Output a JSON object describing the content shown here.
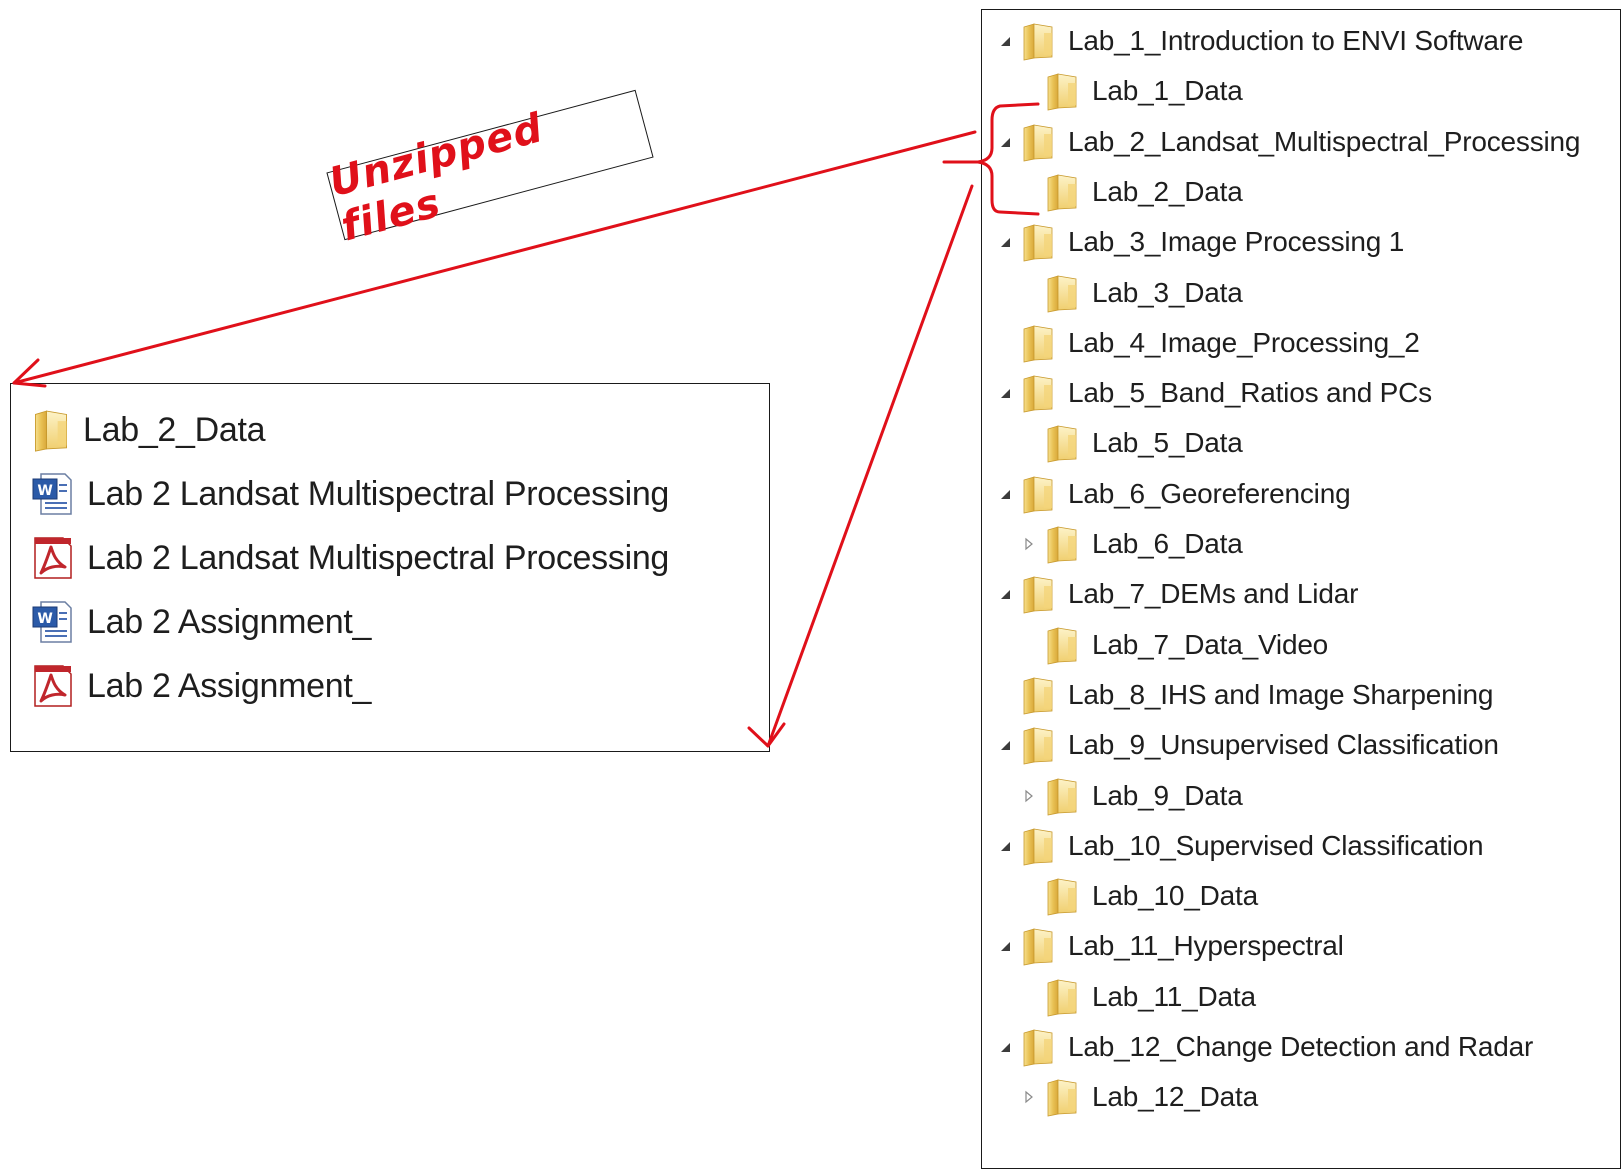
{
  "annotation": {
    "label": "Unzipped files",
    "color": "#e0101a"
  },
  "folder_tree": {
    "items": [
      {
        "label": "Lab_1_Introduction to ENVI Software",
        "level": 0,
        "toggle": "expanded"
      },
      {
        "label": "Lab_1_Data",
        "level": 1,
        "toggle": "none"
      },
      {
        "label": "Lab_2_Landsat_Multispectral_Processing",
        "level": 0,
        "toggle": "expanded"
      },
      {
        "label": "Lab_2_Data",
        "level": 1,
        "toggle": "none"
      },
      {
        "label": "Lab_3_Image Processing 1",
        "level": 0,
        "toggle": "expanded"
      },
      {
        "label": "Lab_3_Data",
        "level": 1,
        "toggle": "none"
      },
      {
        "label": "Lab_4_Image_Processing_2",
        "level": 0,
        "toggle": "none"
      },
      {
        "label": "Lab_5_Band_Ratios and PCs",
        "level": 0,
        "toggle": "expanded"
      },
      {
        "label": "Lab_5_Data",
        "level": 1,
        "toggle": "none"
      },
      {
        "label": "Lab_6_Georeferencing",
        "level": 0,
        "toggle": "expanded"
      },
      {
        "label": "Lab_6_Data",
        "level": 1,
        "toggle": "collapsed"
      },
      {
        "label": "Lab_7_DEMs and Lidar",
        "level": 0,
        "toggle": "expanded"
      },
      {
        "label": "Lab_7_Data_Video",
        "level": 1,
        "toggle": "none"
      },
      {
        "label": "Lab_8_IHS and Image Sharpening",
        "level": 0,
        "toggle": "none"
      },
      {
        "label": "Lab_9_Unsupervised Classification",
        "level": 0,
        "toggle": "expanded"
      },
      {
        "label": "Lab_9_Data",
        "level": 1,
        "toggle": "collapsed"
      },
      {
        "label": "Lab_10_Supervised Classification",
        "level": 0,
        "toggle": "expanded"
      },
      {
        "label": "Lab_10_Data",
        "level": 1,
        "toggle": "none"
      },
      {
        "label": "Lab_11_Hyperspectral",
        "level": 0,
        "toggle": "expanded"
      },
      {
        "label": "Lab_11_Data",
        "level": 1,
        "toggle": "none"
      },
      {
        "label": "Lab_12_Change Detection and Radar",
        "level": 0,
        "toggle": "expanded"
      },
      {
        "label": "Lab_12_Data",
        "level": 1,
        "toggle": "collapsed"
      }
    ]
  },
  "unzipped_files": {
    "items": [
      {
        "label": "Lab_2_Data",
        "icon": "folder-icon"
      },
      {
        "label": "Lab 2  Landsat Multispectral Processing",
        "icon": "word-document-icon"
      },
      {
        "label": "Lab 2  Landsat Multispectral Processing",
        "icon": "pdf-document-icon"
      },
      {
        "label": "Lab 2 Assignment_",
        "icon": "word-document-icon"
      },
      {
        "label": "Lab 2 Assignment_",
        "icon": "pdf-document-icon"
      }
    ]
  }
}
